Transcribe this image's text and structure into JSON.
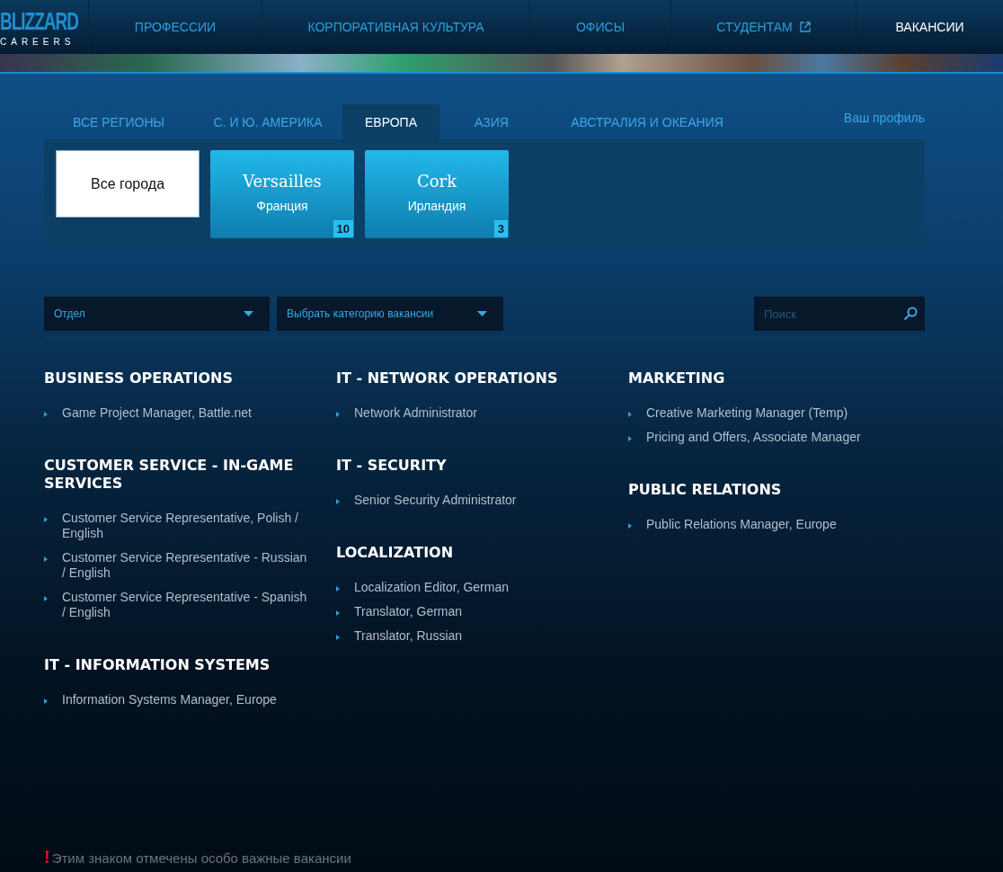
{
  "logo": {
    "brand": "BLIZZARD",
    "subtitle": "CAREERS"
  },
  "nav": [
    {
      "label": "ПРОФЕССИИ",
      "selected": false,
      "external": false
    },
    {
      "label": "КОРПОРАТИВНАЯ КУЛЬТУРА",
      "selected": false,
      "external": false
    },
    {
      "label": "ОФИСЫ",
      "selected": false,
      "external": false
    },
    {
      "label": "СТУДЕНТАМ",
      "selected": false,
      "external": true
    },
    {
      "label": "ВАКАНСИИ",
      "selected": true,
      "external": false
    }
  ],
  "region_tabs": [
    {
      "label": "ВСЕ РЕГИОНЫ",
      "selected": false
    },
    {
      "label": "С. И Ю. АМЕРИКА",
      "selected": false
    },
    {
      "label": "ЕВРОПА",
      "selected": true
    },
    {
      "label": "АЗИЯ",
      "selected": false
    },
    {
      "label": "АВСТРАЛИЯ И ОКЕАНИЯ",
      "selected": false
    }
  ],
  "profile_link": "Ваш профиль",
  "cities": [
    {
      "kind": "all",
      "name": "Все города",
      "selected": true
    },
    {
      "kind": "city",
      "name": "Versailles",
      "country": "Франция",
      "count": "10",
      "selected": false
    },
    {
      "kind": "city",
      "name": "Cork",
      "country": "Ирландия",
      "count": "3",
      "selected": false
    }
  ],
  "filters": {
    "department": "Отдел",
    "category": "Выбрать категорию вакансии",
    "search_placeholder": "Поиск"
  },
  "columns": [
    [
      {
        "title": "BUSINESS OPERATIONS",
        "jobs": [
          "Game Project Manager, Battle.net"
        ]
      },
      {
        "title": "CUSTOMER SERVICE - IN-GAME SERVICES",
        "jobs": [
          "Customer Service Representative, Polish / English",
          "Customer Service Representative - Russian / English",
          "Customer Service Representative - Spanish / English"
        ]
      },
      {
        "title": "IT - INFORMATION SYSTEMS",
        "jobs": [
          "Information Systems Manager, Europe"
        ]
      }
    ],
    [
      {
        "title": "IT - NETWORK OPERATIONS",
        "jobs": [
          "Network Administrator"
        ]
      },
      {
        "title": "IT - SECURITY",
        "jobs": [
          "Senior Security Administrator"
        ]
      },
      {
        "title": "LOCALIZATION",
        "jobs": [
          "Localization Editor, German",
          "Translator, German",
          "Translator, Russian"
        ]
      }
    ],
    [
      {
        "title": "MARKETING",
        "jobs": [
          "Creative Marketing Manager (Temp)",
          "Pricing and Offers, Associate Manager"
        ]
      },
      {
        "title": "PUBLIC RELATIONS",
        "jobs": [
          "Public Relations Manager, Europe"
        ]
      }
    ]
  ],
  "legend": {
    "mark": "!",
    "text": "Этим знаком отмечены особо важные вакансии"
  }
}
